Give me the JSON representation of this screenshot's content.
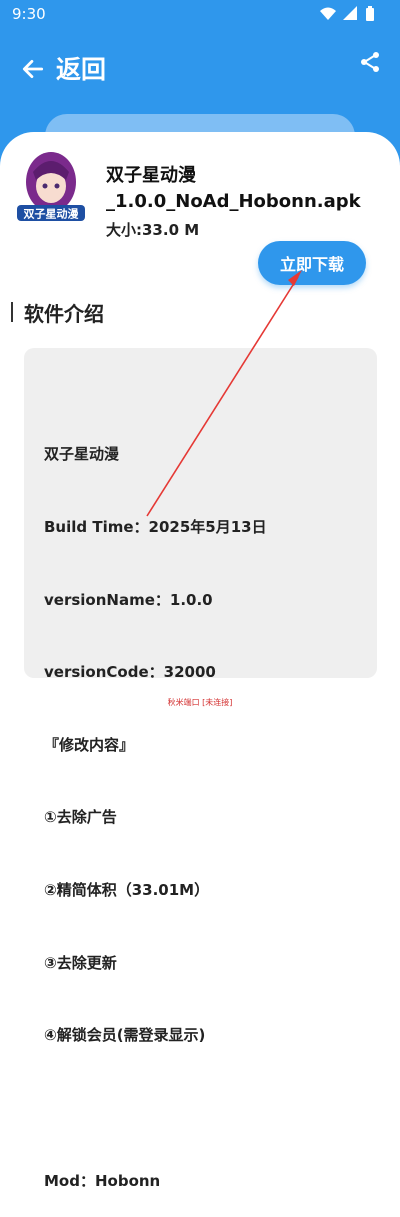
{
  "status_bar": {
    "time": "9:30"
  },
  "nav": {
    "title": "返回"
  },
  "app": {
    "name_line1": "双子星动漫",
    "name_line2": "_1.0.0_NoAd_Hobonn.apk",
    "size": "大小:33.0 M",
    "icon_text": "双子星动漫",
    "download_label": "立即下载"
  },
  "section": {
    "title": "软件介绍"
  },
  "intro": {
    "lines": [
      "双子星动漫",
      "Build Time：2025年5月13日",
      "versionName：1.0.0",
      "versionCode：32000",
      "『修改内容』",
      "①去除广告",
      "②精简体积（33.01M）",
      "③去除更新",
      "④解锁会员(需登录显示)",
      "",
      "Mod：Hobonn"
    ]
  },
  "footer": {
    "text": "秋米端口 [未连接]"
  },
  "colors": {
    "accent": "#2f97ec",
    "annotation": "#e53935"
  }
}
